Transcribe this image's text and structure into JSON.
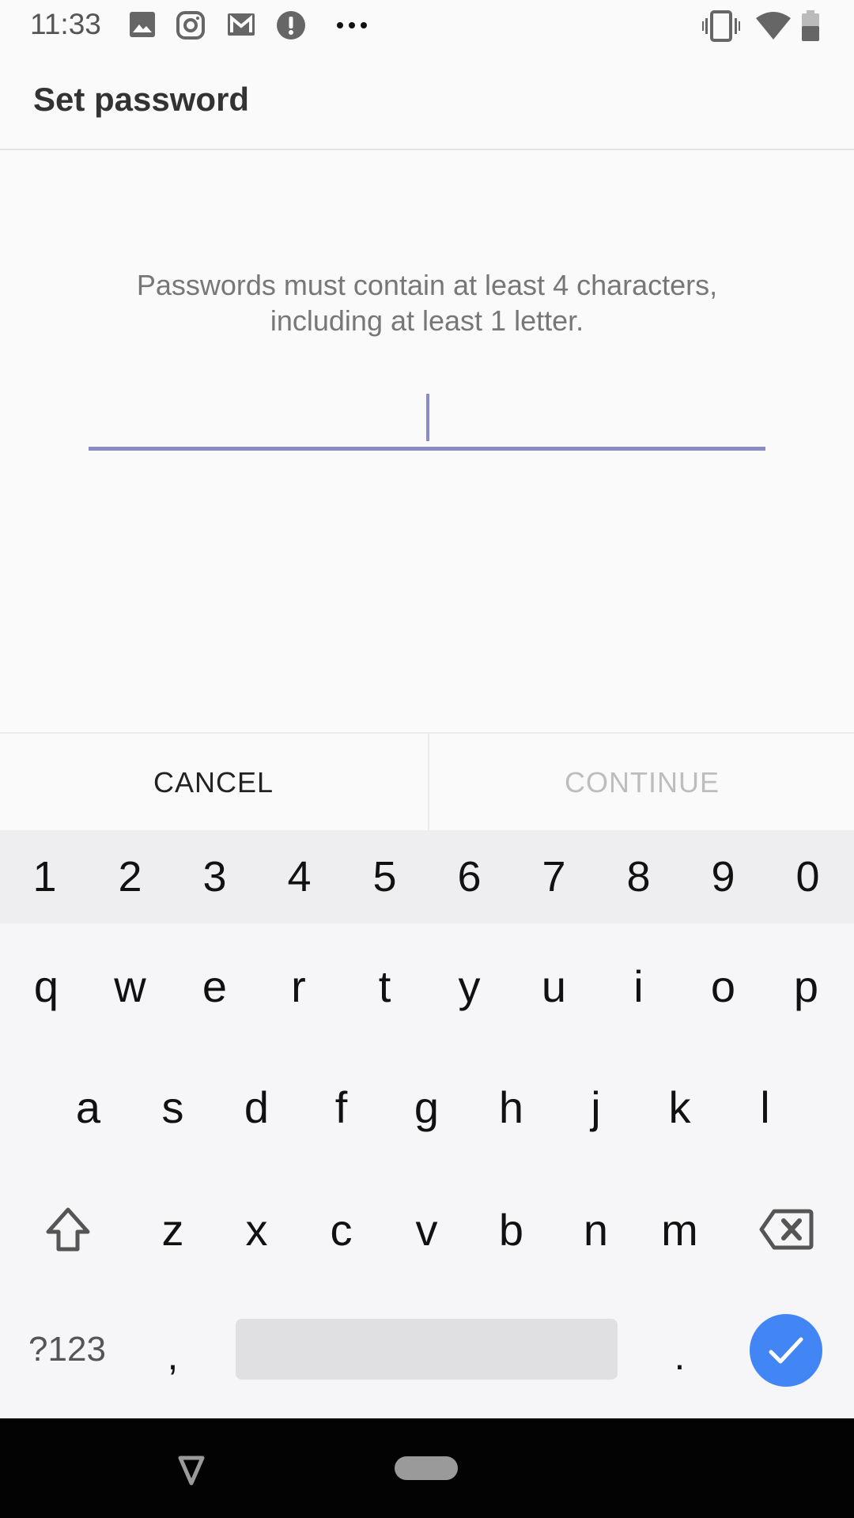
{
  "status_bar": {
    "time": "11:33",
    "notification_icons": [
      "image-icon",
      "instagram-icon",
      "gmail-icon",
      "alert-icon",
      "more-dots-icon"
    ],
    "system_icons": [
      "vibrate-icon",
      "wifi-icon",
      "battery-icon"
    ]
  },
  "app_bar": {
    "title": "Set password"
  },
  "content": {
    "hint_line1": "Passwords must contain at least 4 characters,",
    "hint_line2": "including at least 1 letter.",
    "password_value": "",
    "accent_color": "#8a8cc8"
  },
  "buttons": {
    "cancel": "CANCEL",
    "continue": "CONTINUE",
    "continue_enabled": false
  },
  "keyboard": {
    "number_row": [
      "1",
      "2",
      "3",
      "4",
      "5",
      "6",
      "7",
      "8",
      "9",
      "0"
    ],
    "row1": [
      "q",
      "w",
      "e",
      "r",
      "t",
      "y",
      "u",
      "i",
      "o",
      "p"
    ],
    "row2": [
      "a",
      "s",
      "d",
      "f",
      "g",
      "h",
      "j",
      "k",
      "l"
    ],
    "row3": [
      "z",
      "x",
      "c",
      "v",
      "b",
      "n",
      "m"
    ],
    "symbols_key": "?123",
    "comma_key": ",",
    "period_key": ".",
    "enter_color": "#4285f4"
  },
  "nav_bar": {
    "buttons": [
      "back-icon",
      "home-icon"
    ]
  }
}
